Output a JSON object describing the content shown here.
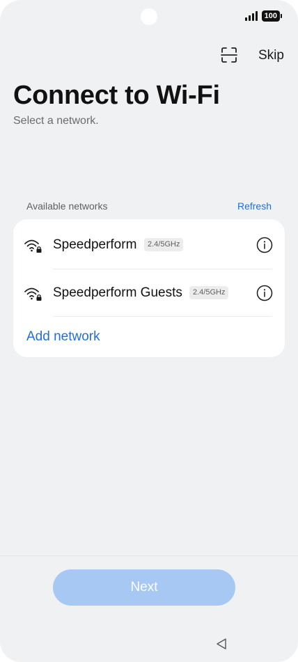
{
  "status_bar": {
    "battery_level": "100"
  },
  "header": {
    "skip_label": "Skip"
  },
  "page": {
    "title": "Connect to Wi-Fi",
    "subtitle": "Select a network."
  },
  "networks_section": {
    "label": "Available networks",
    "refresh_label": "Refresh",
    "networks": [
      {
        "name": "Speedperform",
        "band": "2.4/5GHz",
        "secured": true,
        "icon": "wifi-lock-icon"
      },
      {
        "name": "Speedperform Guests",
        "band": "2.4/5GHz",
        "secured": true,
        "icon": "wifi-lock-icon"
      }
    ],
    "add_network_label": "Add network"
  },
  "footer": {
    "next_label": "Next",
    "next_enabled": false
  },
  "colors": {
    "accent": "#1f6fd8",
    "next_disabled": "#a6c8f2",
    "background": "#f0f1f3"
  }
}
